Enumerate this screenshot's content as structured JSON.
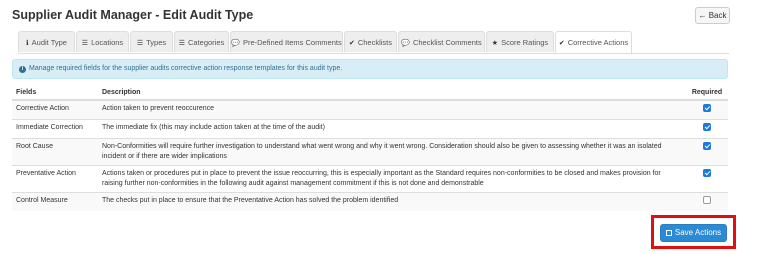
{
  "header": {
    "title": "Supplier Audit Manager - Edit Audit Type",
    "back_label": "Back",
    "back_icon": "←"
  },
  "tabs": [
    {
      "label": "Audit Type",
      "icon": "ℹ"
    },
    {
      "label": "Locations",
      "icon": "☰"
    },
    {
      "label": "Types",
      "icon": "☰"
    },
    {
      "label": "Categories",
      "icon": "☰"
    },
    {
      "label": "Pre-Defined Items Comments",
      "icon": "💬"
    },
    {
      "label": "Checklists",
      "icon": "✔"
    },
    {
      "label": "Checklist Comments",
      "icon": "💬"
    },
    {
      "label": "Score Ratings",
      "icon": "★"
    },
    {
      "label": "Corrective Actions",
      "icon": "✔"
    }
  ],
  "info": {
    "icon": "i",
    "text": "Manage required fields for the supplier audits corrective action response templates for this audit type."
  },
  "table": {
    "headers": {
      "fields": "Fields",
      "description": "Description",
      "required": "Required"
    },
    "rows": [
      {
        "field": "Corrective Action",
        "description": "Action taken to prevent reoccurence",
        "required": true
      },
      {
        "field": "Immediate Correction",
        "description": "The immediate fix (this may include action taken at the time of the audit)",
        "required": true
      },
      {
        "field": "Root Cause",
        "description": "Non-Conformities will require further investigation to understand what went wrong and why it went wrong. Consideration should also be given to assessing whether it was an isolated incident or if there are wider implications",
        "required": true
      },
      {
        "field": "Preventative Action",
        "description": "Actions taken or procedures put in place to prevent the issue reoccurring, this is especially important as the Standard requires non-conformities to be closed and makes provision for raising further non-conformities in the following audit against management commitment if this is not done and demonstrable",
        "required": true
      },
      {
        "field": "Control Measure",
        "description": "The checks put in place to ensure that the Preventative Action has solved the problem identified",
        "required": false
      }
    ]
  },
  "save_button": {
    "label": "Save Actions"
  },
  "colors": {
    "accent": "#2a8bd4",
    "highlight": "#e01010",
    "info_bg": "#d9edf7"
  }
}
